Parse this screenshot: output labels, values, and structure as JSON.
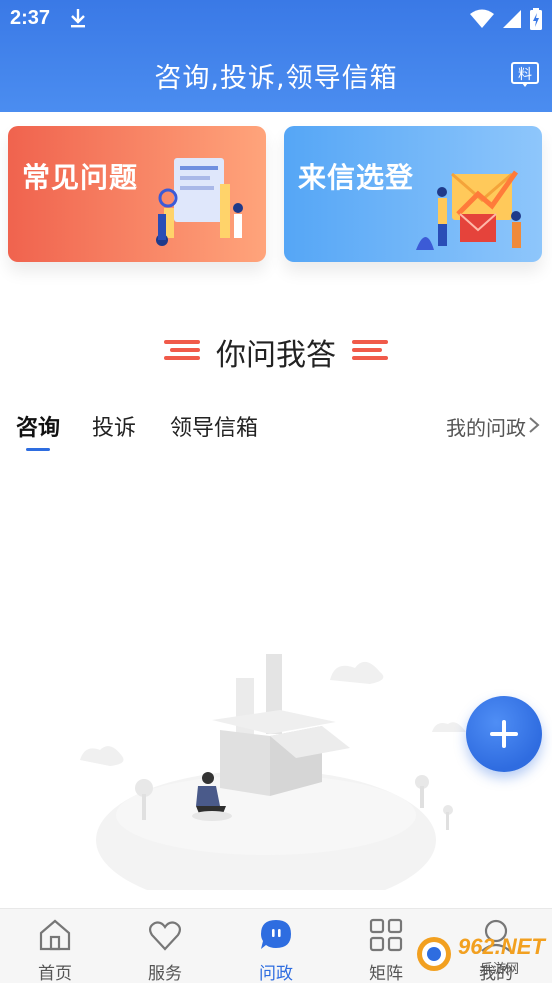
{
  "status_bar": {
    "time": "2:37"
  },
  "header": {
    "title": "咨询,投诉,领导信箱",
    "right_icon": "news-icon",
    "right_icon_text": "料"
  },
  "cards": [
    {
      "title": "常见问题",
      "icon": "faq-illustration"
    },
    {
      "title": "来信选登",
      "icon": "letters-illustration"
    }
  ],
  "section": {
    "title": "你问我答"
  },
  "tabs": [
    {
      "label": "咨询",
      "active": true
    },
    {
      "label": "投诉",
      "active": false
    },
    {
      "label": "领导信箱",
      "active": false
    }
  ],
  "my_questions": {
    "label": "我的问政"
  },
  "fab": {
    "icon": "plus-icon"
  },
  "bottom_nav": [
    {
      "label": "首页",
      "icon": "home-icon",
      "active": false
    },
    {
      "label": "服务",
      "icon": "heart-icon",
      "active": false
    },
    {
      "label": "问政",
      "icon": "chat-bubble-icon",
      "active": true
    },
    {
      "label": "矩阵",
      "icon": "grid-icon",
      "active": false
    },
    {
      "label": "我的",
      "icon": "user-icon",
      "active": false
    }
  ],
  "watermark": {
    "text": "962.NET",
    "sub": "乐游网"
  },
  "colors": {
    "primary": "#2e6de0",
    "header": "#3a79e6",
    "faq_card": "#f0634e",
    "letters_card": "#55a6f6"
  }
}
